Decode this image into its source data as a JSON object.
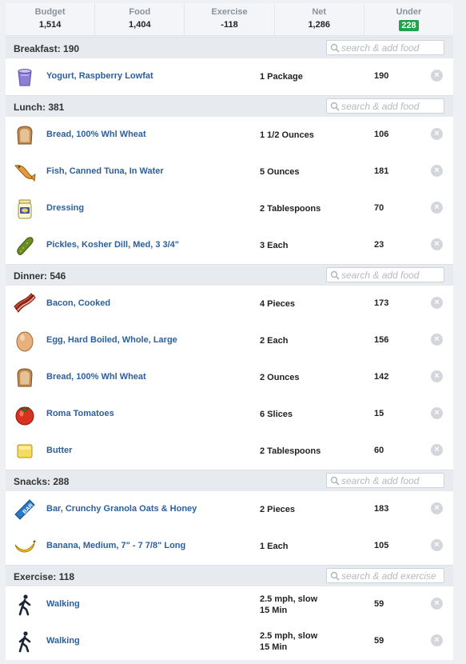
{
  "summary": [
    {
      "label": "Budget",
      "value": "1,514"
    },
    {
      "label": "Food",
      "value": "1,404"
    },
    {
      "label": "Exercise",
      "value": "-118"
    },
    {
      "label": "Net",
      "value": "1,286"
    },
    {
      "label": "Under",
      "value": "228"
    }
  ],
  "colors": {
    "link": "#2b5f9e",
    "under_badge": "#1fa349",
    "header_bg": "#e7eaee"
  },
  "sections": [
    {
      "title": "Breakfast: 190",
      "placeholder": "search & add food",
      "items": [
        {
          "icon": "yogurt-icon",
          "name": "Yogurt, Raspberry Lowfat",
          "qty": [
            "1 Package"
          ],
          "cal": "190"
        }
      ]
    },
    {
      "title": "Lunch: 381",
      "placeholder": "search & add food",
      "items": [
        {
          "icon": "bread-icon",
          "name": "Bread, 100% Whl Wheat",
          "qty": [
            "1 1/2 Ounces"
          ],
          "cal": "106"
        },
        {
          "icon": "fish-icon",
          "name": "Fish, Canned Tuna, In Water",
          "qty": [
            "5 Ounces"
          ],
          "cal": "181"
        },
        {
          "icon": "dressing-jar-icon",
          "name": "Dressing",
          "qty": [
            "2 Tablespoons"
          ],
          "cal": "70"
        },
        {
          "icon": "pickle-icon",
          "name": "Pickles, Kosher Dill, Med, 3 3/4\"",
          "qty": [
            "3 Each"
          ],
          "cal": "23"
        }
      ]
    },
    {
      "title": "Dinner: 546",
      "placeholder": "search & add food",
      "items": [
        {
          "icon": "bacon-icon",
          "name": "Bacon, Cooked",
          "qty": [
            "4 Pieces"
          ],
          "cal": "173"
        },
        {
          "icon": "egg-icon",
          "name": "Egg, Hard Boiled, Whole, Large",
          "qty": [
            "2 Each"
          ],
          "cal": "156"
        },
        {
          "icon": "bread-icon",
          "name": "Bread, 100% Whl Wheat",
          "qty": [
            "2 Ounces"
          ],
          "cal": "142"
        },
        {
          "icon": "tomato-icon",
          "name": "Roma Tomatoes",
          "qty": [
            "6 Slices"
          ],
          "cal": "15"
        },
        {
          "icon": "butter-icon",
          "name": "Butter",
          "qty": [
            "2 Tablespoons"
          ],
          "cal": "60"
        }
      ]
    },
    {
      "title": "Snacks: 288",
      "placeholder": "search & add food",
      "items": [
        {
          "icon": "granola-bar-icon",
          "name": "Bar, Crunchy Granola Oats & Honey",
          "qty": [
            "2 Pieces"
          ],
          "cal": "183"
        },
        {
          "icon": "banana-icon",
          "name": "Banana, Medium, 7\" - 7 7/8\" Long",
          "qty": [
            "1 Each"
          ],
          "cal": "105"
        }
      ]
    },
    {
      "title": "Exercise: 118",
      "placeholder": "search & add exercise",
      "items": [
        {
          "icon": "walking-icon",
          "name": "Walking",
          "qty": [
            "2.5 mph, slow",
            "15 Min"
          ],
          "cal": "59"
        },
        {
          "icon": "walking-icon",
          "name": "Walking",
          "qty": [
            "2.5 mph, slow",
            "15 Min"
          ],
          "cal": "59"
        }
      ]
    }
  ]
}
